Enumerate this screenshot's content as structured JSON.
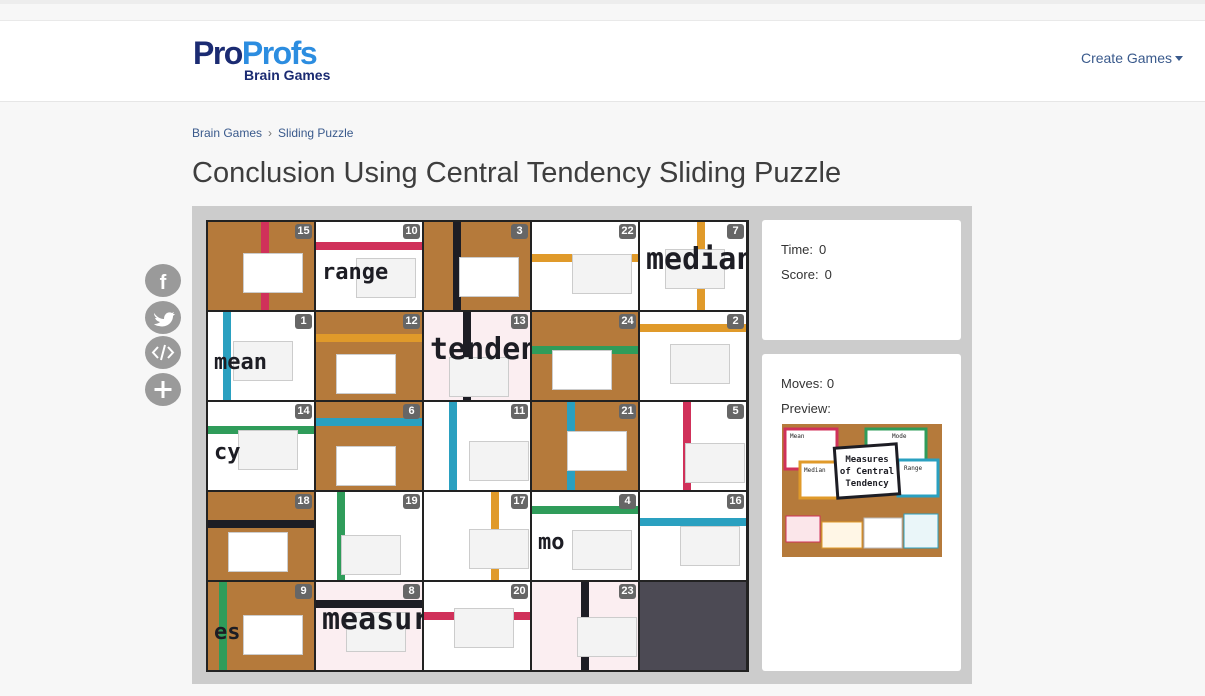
{
  "brand": {
    "name_a": "Pro",
    "name_b": "Profs",
    "sub": "Brain Games",
    "colors": {
      "dark": "#1b2b72",
      "light": "#2c8de0"
    }
  },
  "nav": {
    "create_games": "Create Games"
  },
  "breadcrumb": {
    "items": [
      "Brain Games",
      "Sliding Puzzle"
    ],
    "separator": "›"
  },
  "page": {
    "title": "Conclusion Using Central Tendency Sliding Puzzle"
  },
  "social": [
    {
      "name": "facebook-share-button",
      "icon": "facebook-icon",
      "glyph": "f"
    },
    {
      "name": "twitter-share-button",
      "icon": "twitter-icon",
      "glyph": "bird"
    },
    {
      "name": "embed-button",
      "icon": "embed-code-icon",
      "glyph": "</>"
    },
    {
      "name": "more-share-button",
      "icon": "plus-icon",
      "glyph": "+"
    }
  ],
  "puzzle": {
    "rows": 5,
    "cols": 5,
    "tiles": [
      15,
      10,
      3,
      22,
      7,
      1,
      12,
      13,
      24,
      2,
      14,
      6,
      11,
      21,
      5,
      18,
      19,
      17,
      4,
      16,
      9,
      8,
      20,
      23,
      null
    ],
    "tile_words": {
      "10": "range",
      "7": "median",
      "1": "mean",
      "13": "tenden",
      "14": "cy",
      "9": "es",
      "8": "measur",
      "4": "mo"
    }
  },
  "stats": {
    "time_label": "Time:",
    "time_value": "0",
    "score_label": "Score:",
    "score_value": "0",
    "moves_label": "Moves:",
    "moves_value": "0",
    "preview_label": "Preview:",
    "preview_text": "Measures of Central Tendency",
    "preview_cards": [
      "Mean",
      "Mode",
      "Median",
      "Range"
    ]
  }
}
